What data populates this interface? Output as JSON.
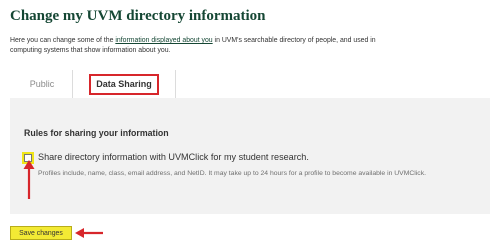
{
  "page": {
    "title": "Change my UVM directory information",
    "intro_before": "Here you can change some of the ",
    "intro_link": "information displayed about you",
    "intro_after": " in UVM's searchable directory of people, and used in computing systems that show information about you."
  },
  "tabs": [
    {
      "label": "Public",
      "active": false
    },
    {
      "label": "Data Sharing",
      "active": true
    }
  ],
  "sharing": {
    "heading": "Rules for sharing your information",
    "checkbox_label": "Share directory information with UVMClick for my student research.",
    "checkbox_checked": false,
    "help": "Profiles include, name, class, email address, and NetID. It may take up to 24 hours for a profile to become available in UVMClick."
  },
  "form": {
    "save_label": "Save changes"
  },
  "colors": {
    "title_green": "#154734",
    "highlight_yellow": "#f3ea34",
    "annotation_red": "#d7262b",
    "panel_gray": "#f2f2f2"
  },
  "icons": {
    "annotations": [
      "arrow-up-icon",
      "arrow-left-icon"
    ]
  }
}
